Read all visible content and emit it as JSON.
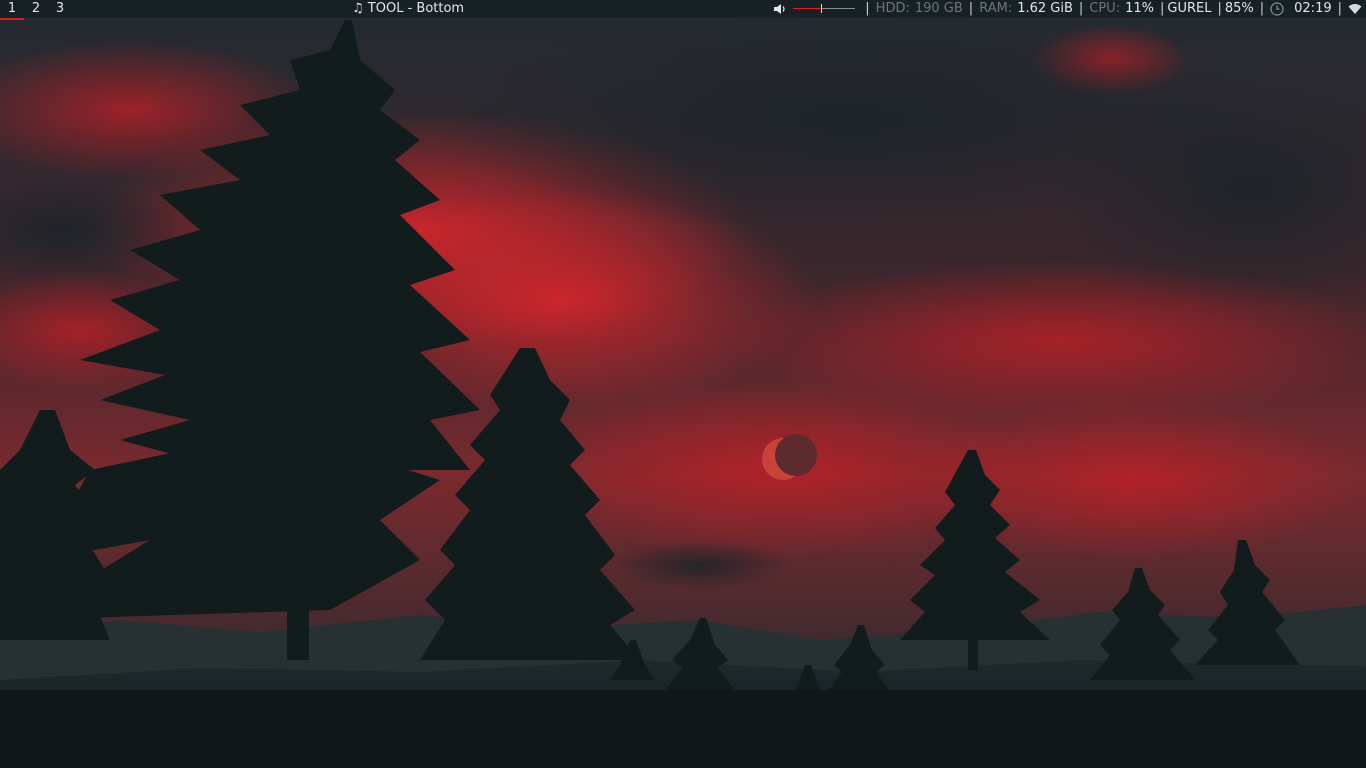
{
  "workspaces": [
    {
      "label": "1",
      "active": true
    },
    {
      "label": "2",
      "active": false
    },
    {
      "label": "3",
      "active": false
    }
  ],
  "now_playing": {
    "icon": "music-note-icon",
    "text": "TOOL - Bottom"
  },
  "volume": {
    "icon": "speaker-icon",
    "level": 0.45
  },
  "hdd": {
    "label": "HDD:",
    "value": "190 GB"
  },
  "ram": {
    "label": "RAM:",
    "value": "1.62 GiB"
  },
  "cpu": {
    "label": "CPU:",
    "value": "11%"
  },
  "keyboard_layout": "GUREL",
  "battery": "85%",
  "clock": {
    "icon": "clock-icon",
    "time": "02:19"
  },
  "network": {
    "icon": "wifi-icon"
  },
  "colors": {
    "accent": "#d62121",
    "bar_background": "#141d21",
    "text": "#e6e6e6",
    "dim_text": "#6f7579"
  }
}
